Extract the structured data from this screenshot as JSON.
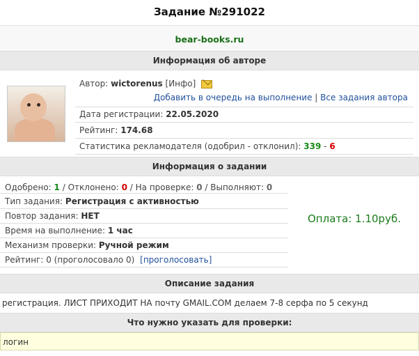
{
  "header": {
    "title": "Задание №291022"
  },
  "site": {
    "name": "bear-books.ru"
  },
  "author_section": {
    "title": "Информация об авторе",
    "author_label": "Автор:",
    "author_name": "wictorenus",
    "info_link": "[Инфо]",
    "add_queue": "Добавить в очередь на выполнение",
    "separator": "|",
    "all_tasks": "Все задания автора",
    "reg_label": "Дата регистрации:",
    "reg_date": "22.05.2020",
    "rating_label": "Рейтинг:",
    "rating_value": "174.68",
    "stats_label": "Статистика рекламодателя (одобрил - отклонил):",
    "stats_approved": "339",
    "stats_dash": "-",
    "stats_rejected": "6"
  },
  "task_section": {
    "title": "Информация о задании",
    "approved_label": "Одобрено:",
    "approved": "1",
    "rejected_label": "/ Отклонено:",
    "rejected": "0",
    "checking_label": "/ На проверке:",
    "checking": "0",
    "doing_label": "/ Выполняют:",
    "doing": "0",
    "type_label": "Тип задания:",
    "type_value": "Регистрация с активностью",
    "repeat_label": "Повтор задания:",
    "repeat_value": "НЕТ",
    "time_label": "Время на выполнение:",
    "time_value": "1 час",
    "check_label": "Механизм проверки:",
    "check_value": "Ручной режим",
    "rating_text": "Рейтинг: 0 (проголосовало 0)",
    "vote_link": "[проголосовать]",
    "payment": "Оплата: 1.10руб."
  },
  "description_section": {
    "title": "Описание задания",
    "text": "регистрация. ЛИСТ ПРИХОДИТ НА почту GMAIL.COM  делаем 7-8 серфа по 5 секунд"
  },
  "verify_section": {
    "title": "Что нужно указать для проверки:",
    "value": "логин"
  },
  "icons": {
    "mail": "envelope-icon",
    "avatar": "baby-photo"
  }
}
